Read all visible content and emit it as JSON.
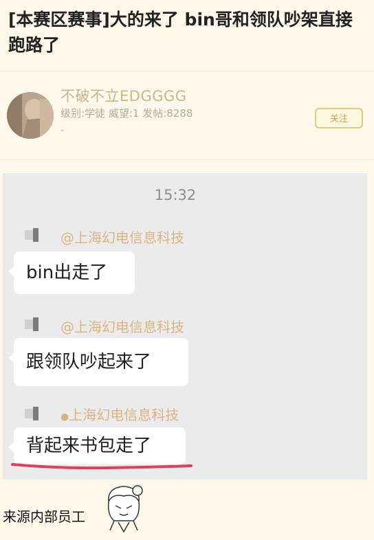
{
  "post": {
    "title": "[本赛区赛事]大的来了 bin哥和领队吵架直接跑路了"
  },
  "user": {
    "name": "不破不立EDGGGG",
    "stats": "级别:学徒 威望:1 发帖:8288",
    "dash": "-",
    "follow_label": "关注"
  },
  "chat": {
    "timestamp": "15:32",
    "messages": [
      {
        "sender": "@上海幻电信息科技",
        "text": "bin出走了"
      },
      {
        "sender": "@上海幻电信息科技",
        "text": "跟领队吵起来了"
      },
      {
        "sender": "上海幻电信息科技",
        "text": "背起来书包走了"
      }
    ]
  },
  "footer": {
    "source": "来源内部员工"
  },
  "colors": {
    "background": "#fdf8ea",
    "chat_background": "#ebebeb",
    "accent_gold": "#d9b483",
    "underline_red": "#e0405a"
  }
}
